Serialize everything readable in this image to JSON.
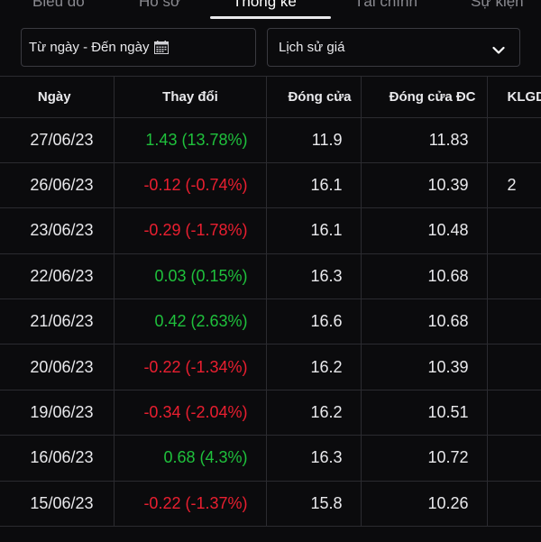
{
  "tabs": [
    {
      "label": "Biểu đồ",
      "active": false
    },
    {
      "label": "Hồ sơ",
      "active": false
    },
    {
      "label": "Thống kê",
      "active": true
    },
    {
      "label": "Tài chính",
      "active": false
    },
    {
      "label": "Sự kiện",
      "active": false
    }
  ],
  "filters": {
    "date_range_label": "Từ ngày - Đến ngày",
    "history_type_label": "Lịch sử giá"
  },
  "table": {
    "headers": [
      "Ngày",
      "Thay đổi",
      "Đóng cửa",
      "Đóng cửa ĐC",
      "KLGD"
    ],
    "rows": [
      {
        "date": "27/06/23",
        "change": "1.43 (13.78%)",
        "direction": "up",
        "close": "11.9",
        "adj_close": "11.83",
        "volume": ""
      },
      {
        "date": "26/06/23",
        "change": "-0.12 (-0.74%)",
        "direction": "down",
        "close": "16.1",
        "adj_close": "10.39",
        "volume": "2"
      },
      {
        "date": "23/06/23",
        "change": "-0.29 (-1.78%)",
        "direction": "down",
        "close": "16.1",
        "adj_close": "10.48",
        "volume": ""
      },
      {
        "date": "22/06/23",
        "change": "0.03 (0.15%)",
        "direction": "up",
        "close": "16.3",
        "adj_close": "10.68",
        "volume": ""
      },
      {
        "date": "21/06/23",
        "change": "0.42 (2.63%)",
        "direction": "up",
        "close": "16.6",
        "adj_close": "10.68",
        "volume": ""
      },
      {
        "date": "20/06/23",
        "change": "-0.22 (-1.34%)",
        "direction": "down",
        "close": "16.2",
        "adj_close": "10.39",
        "volume": ""
      },
      {
        "date": "19/06/23",
        "change": "-0.34 (-2.04%)",
        "direction": "down",
        "close": "16.2",
        "adj_close": "10.51",
        "volume": ""
      },
      {
        "date": "16/06/23",
        "change": "0.68 (4.3%)",
        "direction": "up",
        "close": "16.3",
        "adj_close": "10.72",
        "volume": ""
      },
      {
        "date": "15/06/23",
        "change": "-0.22 (-1.37%)",
        "direction": "down",
        "close": "15.8",
        "adj_close": "10.26",
        "volume": ""
      }
    ]
  },
  "colors": {
    "up": "#1fc13c",
    "down": "#ea1f30",
    "background": "#0b0b0d"
  },
  "icons": {
    "date_filter": "calendar-icon",
    "type_filter": "chevron-down-icon"
  }
}
